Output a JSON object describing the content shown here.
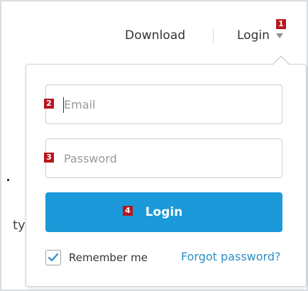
{
  "nav": {
    "download_label": "Download",
    "login_label": "Login",
    "login_caret_icon": "caret-down-icon"
  },
  "background": {
    "partial_text": "ty"
  },
  "login_form": {
    "email_placeholder": "Email",
    "email_value": "",
    "password_placeholder": "Password",
    "password_value": "",
    "submit_label": "Login",
    "remember_label": "Remember me",
    "remember_checked": true,
    "forgot_label": "Forgot password?"
  },
  "annotations": [
    {
      "number": "1"
    },
    {
      "number": "2"
    },
    {
      "number": "3"
    },
    {
      "number": "4"
    }
  ],
  "colors": {
    "primary_button": "#1b99d8",
    "link": "#2a8fc9",
    "badge": "#b8171d",
    "border": "#cdd2d6"
  }
}
